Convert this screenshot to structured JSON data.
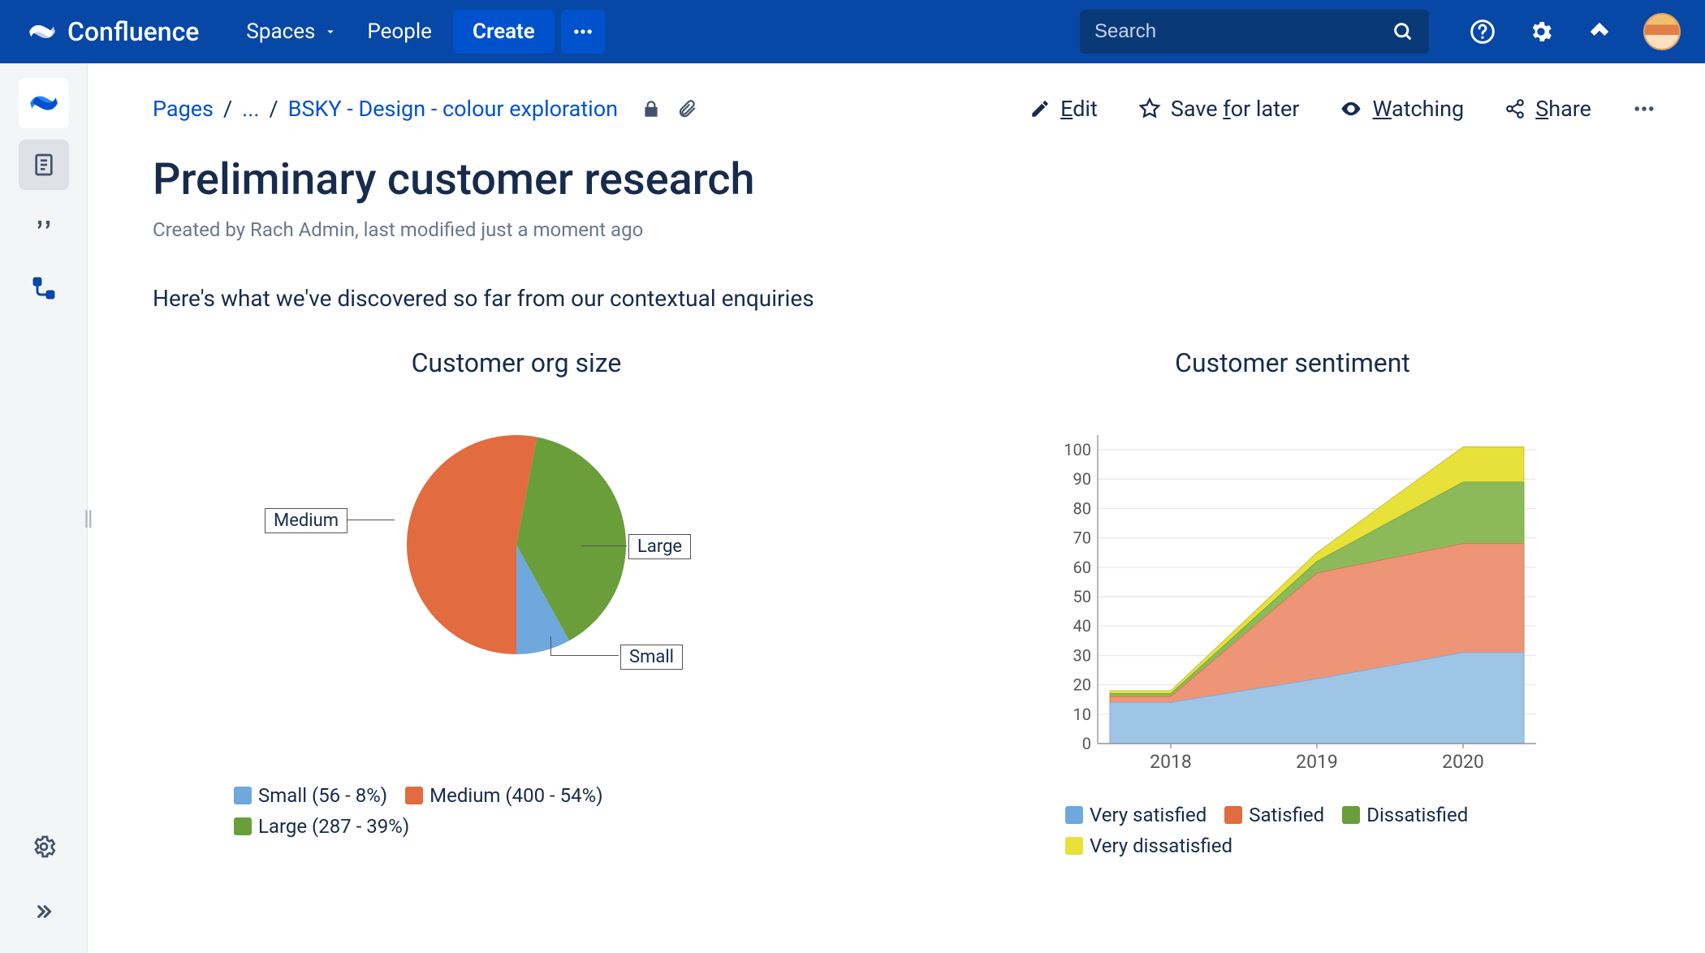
{
  "brand": "Confluence",
  "nav": {
    "spaces": "Spaces",
    "people": "People",
    "create": "Create"
  },
  "search": {
    "placeholder": "Search"
  },
  "breadcrumb": {
    "root": "Pages",
    "ellipsis": "...",
    "current": "BSKY - Design - colour exploration"
  },
  "actions": {
    "edit": "Edit",
    "save": "Save for later",
    "watching": "Watching",
    "share": "Share"
  },
  "page": {
    "title": "Preliminary customer research",
    "byline": "Created by Rach Admin, last modified just a moment ago",
    "intro": "Here's what we've discovered so far from our contextual enquiries"
  },
  "chart1": {
    "title": "Customer org size",
    "callouts": {
      "medium": "Medium",
      "large": "Large",
      "small": "Small"
    },
    "legend": {
      "small": "Small (56 - 8%)",
      "medium": "Medium (400 - 54%)",
      "large": "Large (287 - 39%)"
    }
  },
  "chart2": {
    "title": "Customer sentiment",
    "yticks": [
      "0",
      "10",
      "20",
      "30",
      "40",
      "50",
      "60",
      "70",
      "80",
      "90",
      "100"
    ],
    "xticks": [
      "2018",
      "2019",
      "2020"
    ],
    "legend": {
      "vs": "Very satisfied",
      "s": "Satisfied",
      "d": "Dissatisfied",
      "vd": "Very dissatisfied"
    }
  },
  "colors": {
    "blue": "#6ea8dc",
    "orange": "#e26b3f",
    "green": "#6a9e3a",
    "yellow": "#e7e13a"
  },
  "chart_data": [
    {
      "type": "pie",
      "title": "Customer org size",
      "series": [
        {
          "name": "Small",
          "value": 56,
          "percent": 8
        },
        {
          "name": "Medium",
          "value": 400,
          "percent": 54
        },
        {
          "name": "Large",
          "value": 287,
          "percent": 39
        }
      ]
    },
    {
      "type": "area",
      "title": "Customer sentiment",
      "stacked": true,
      "x": [
        "2018",
        "2019",
        "2020"
      ],
      "ylim": [
        0,
        100
      ],
      "series": [
        {
          "name": "Very satisfied",
          "values": [
            14,
            22,
            31
          ]
        },
        {
          "name": "Satisfied",
          "values": [
            2,
            36,
            37
          ]
        },
        {
          "name": "Dissatisfied",
          "values": [
            1,
            4,
            21
          ]
        },
        {
          "name": "Very dissatisfied",
          "values": [
            1,
            3,
            12
          ]
        }
      ],
      "cumulative": [
        [
          14,
          22,
          31
        ],
        [
          16,
          58,
          68
        ],
        [
          17,
          62,
          89
        ],
        [
          18,
          65,
          101
        ]
      ]
    }
  ]
}
